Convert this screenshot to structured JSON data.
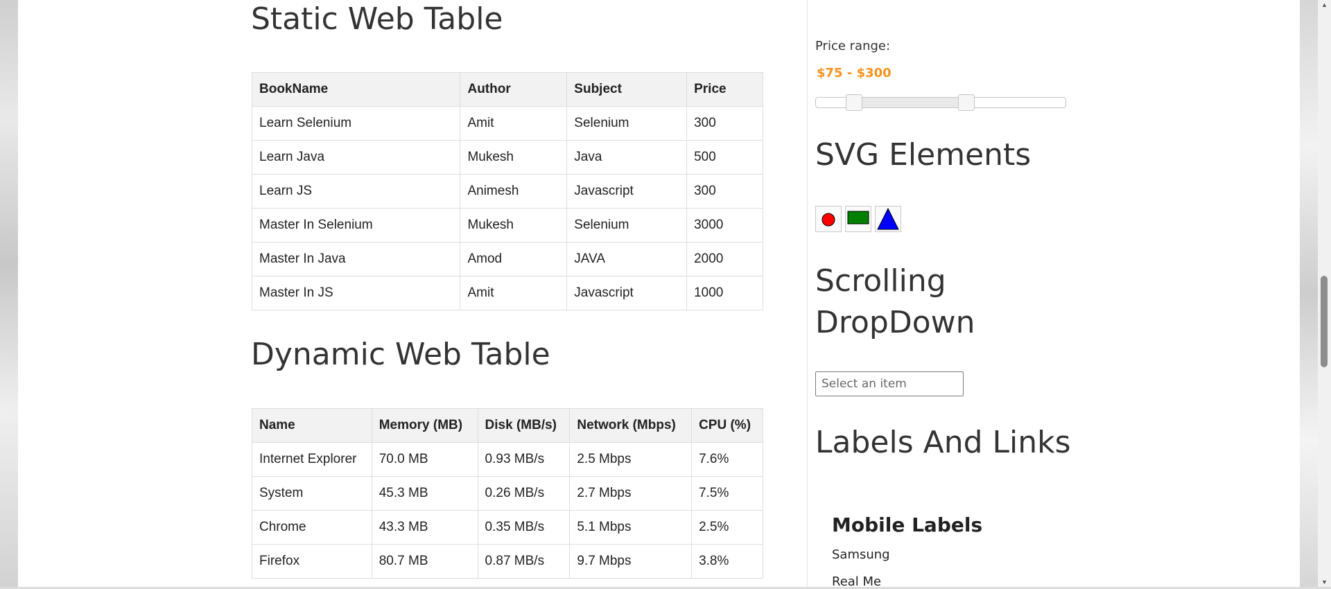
{
  "static_table": {
    "heading": "Static Web Table",
    "headers": [
      "BookName",
      "Author",
      "Subject",
      "Price"
    ],
    "rows": [
      [
        "Learn Selenium",
        "Amit",
        "Selenium",
        "300"
      ],
      [
        "Learn Java",
        "Mukesh",
        "Java",
        "500"
      ],
      [
        "Learn JS",
        "Animesh",
        "Javascript",
        "300"
      ],
      [
        "Master In Selenium",
        "Mukesh",
        "Selenium",
        "3000"
      ],
      [
        "Master In Java",
        "Amod",
        "JAVA",
        "2000"
      ],
      [
        "Master In JS",
        "Amit",
        "Javascript",
        "1000"
      ]
    ]
  },
  "dynamic_table": {
    "heading": "Dynamic Web Table",
    "headers": [
      "Name",
      "Memory (MB)",
      "Disk (MB/s)",
      "Network (Mbps)",
      "CPU (%)"
    ],
    "rows": [
      [
        "Internet Explorer",
        "70.0 MB",
        "0.93 MB/s",
        "2.5 Mbps",
        "7.6%"
      ],
      [
        "System",
        "45.3 MB",
        "0.26 MB/s",
        "2.7 Mbps",
        "7.5%"
      ],
      [
        "Chrome",
        "43.3 MB",
        "0.35 MB/s",
        "5.1 Mbps",
        "2.5%"
      ],
      [
        "Firefox",
        "80.7 MB",
        "0.87 MB/s",
        "9.7 Mbps",
        "3.8%"
      ]
    ]
  },
  "price_range": {
    "label": "Price range:",
    "value_text": "$75 - $300",
    "slider_low_fraction": 0.15,
    "slider_high_fraction": 0.6,
    "value_color": "#f6931f"
  },
  "svg_elements": {
    "heading": "SVG Elements",
    "shapes": [
      {
        "icon": "red-circle-icon",
        "color": "#ff0000"
      },
      {
        "icon": "green-rectangle-icon",
        "color": "#008000"
      },
      {
        "icon": "blue-triangle-icon",
        "color": "#0000ff"
      }
    ]
  },
  "scrolling_dropdown": {
    "heading_line1": "Scrolling",
    "heading_line2": "DropDown",
    "placeholder": "Select an item"
  },
  "labels_links": {
    "heading": "Labels And Links",
    "mobile_heading": "Mobile Labels",
    "items": [
      "Samsung",
      "Real Me"
    ]
  }
}
